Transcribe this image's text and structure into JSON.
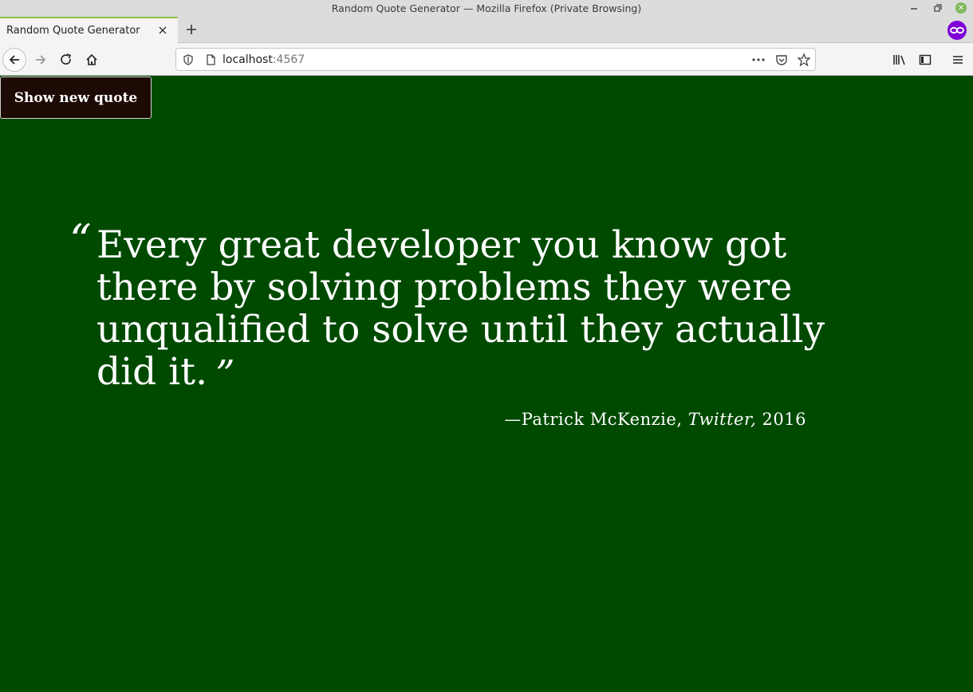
{
  "window": {
    "title": "Random Quote Generator — Mozilla Firefox (Private Browsing)"
  },
  "tabs": [
    {
      "label": "Random Quote Generator",
      "active": true
    }
  ],
  "nav": {
    "url_host": "localhost",
    "url_port": ":4567"
  },
  "colors": {
    "page_background": "#004a00",
    "button_background": "#1e0a05",
    "text": "#ffffff",
    "private_badge": "#8000d7",
    "tab_accent": "#8cbf4c"
  },
  "page": {
    "button_label": "Show new quote",
    "quote": {
      "open_mark": "“",
      "text": "Every great developer you know got there by solving problems they were unqualified to solve until they actually did it.",
      "close_mark": "”",
      "author": "—Patrick McKenzie,",
      "source": "Twitter,",
      "year": "2016"
    }
  }
}
